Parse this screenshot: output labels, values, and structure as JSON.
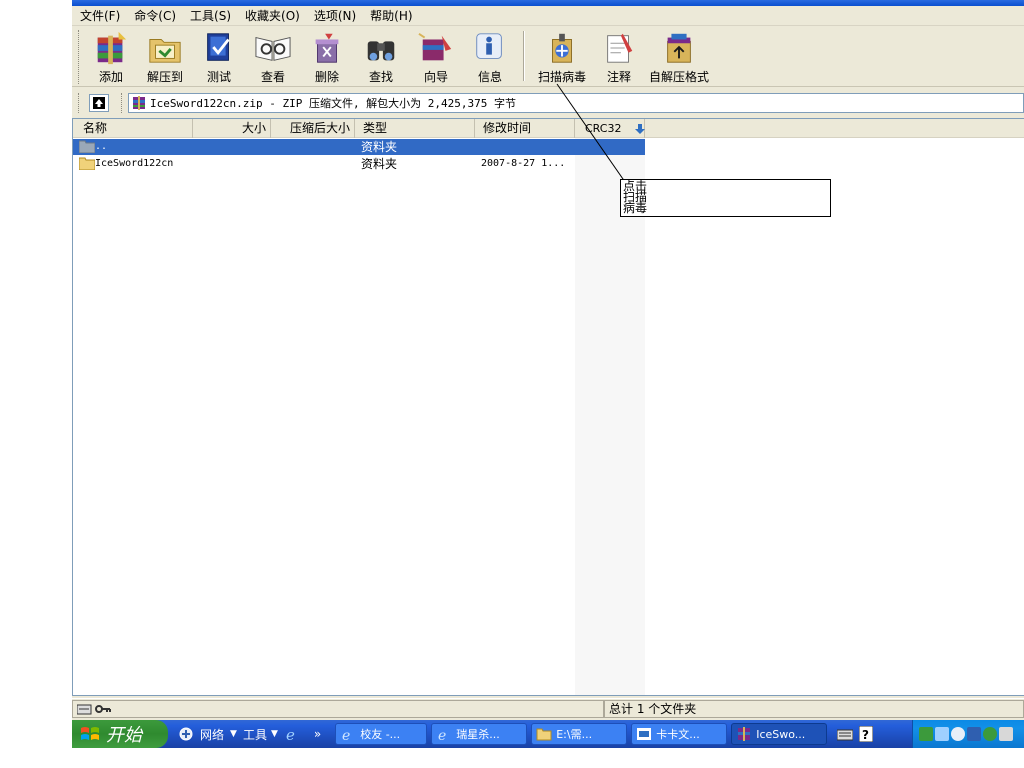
{
  "menu": [
    "文件(F)",
    "命令(C)",
    "工具(S)",
    "收藏夹(O)",
    "选项(N)",
    "帮助(H)"
  ],
  "toolbar": {
    "add": "添加",
    "extract": "解压到",
    "test": "测试",
    "view": "查看",
    "delete": "删除",
    "find": "查找",
    "wizard": "向导",
    "info": "信息",
    "scan": "扫描病毒",
    "comment": "注释",
    "sfx": "自解压格式"
  },
  "address": {
    "path": "IceSword122cn.zip - ZIP 压缩文件, 解包大小为 2,425,375 字节"
  },
  "columns": {
    "name": "名称",
    "size": "大小",
    "packed": "压缩后大小",
    "type": "类型",
    "modified": "修改时间",
    "crc": "CRC32"
  },
  "rows": [
    {
      "name": "..",
      "size": "",
      "packed": "",
      "type": "资料夹",
      "modified": ""
    },
    {
      "name": "IceSword122cn",
      "size": "",
      "packed": "",
      "type": "资料夹",
      "modified": "2007-8-27 1..."
    }
  ],
  "callout": {
    "line1": "点击",
    "line2": "扫描",
    "line3": "病毒"
  },
  "status": {
    "summary": "总计 1 个文件夹"
  },
  "taskbar": {
    "start": "开始",
    "network": "网络",
    "tools": "工具",
    "chevron": "»",
    "tasks": [
      {
        "label": "校友 -..."
      },
      {
        "label": "瑞星杀..."
      },
      {
        "label": "E:\\需..."
      },
      {
        "label": "卡卡文..."
      },
      {
        "label": "IceSwo..."
      }
    ]
  },
  "colors": {
    "selection": "#316ac5",
    "taskbar": "#245edb",
    "start": "#3c9a3c",
    "window": "#ece9d8"
  }
}
